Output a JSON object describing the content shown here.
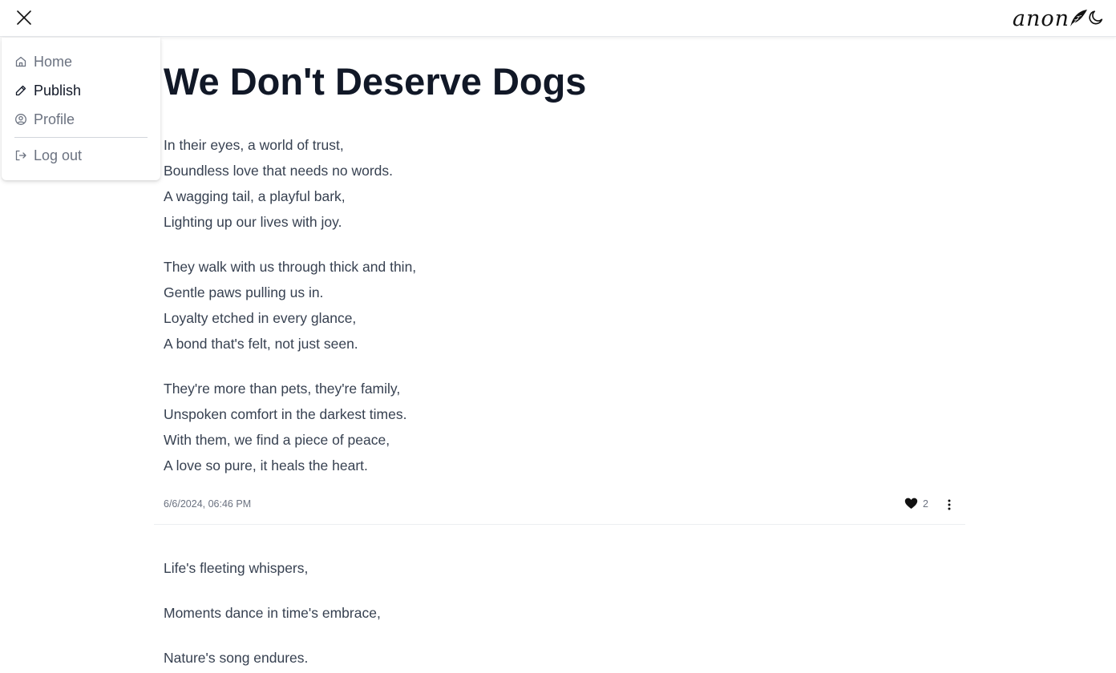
{
  "header": {
    "brand": "anon",
    "brand_icon": "feather-icon",
    "close_icon": "close-icon",
    "theme_icon": "moon-icon"
  },
  "menu": {
    "items": [
      {
        "label": "Home",
        "icon": "home-icon"
      },
      {
        "label": "Publish",
        "icon": "pencil-icon"
      },
      {
        "label": "Profile",
        "icon": "user-circle-icon"
      },
      {
        "label": "Log out",
        "icon": "logout-icon"
      }
    ]
  },
  "posts": [
    {
      "title": "We Don't Deserve Dogs",
      "stanzas": [
        [
          "In their eyes, a world of trust,",
          "Boundless love that needs no words.",
          "A wagging tail, a playful bark,",
          "Lighting up our lives with joy."
        ],
        [
          "They walk with us through thick and thin,",
          "Gentle paws pulling us in.",
          "Loyalty etched in every glance,",
          "A bond that's felt, not just seen."
        ],
        [
          "They're more than pets, they're family,",
          "Unspoken comfort in the darkest times.",
          "With them, we find a piece of peace,",
          "A love so pure, it heals the heart."
        ]
      ],
      "date": "6/6/2024, 06:46 PM",
      "likes": "2"
    },
    {
      "title": "",
      "stanzas": [
        [
          "Life's fleeting whispers,"
        ],
        [
          "Moments dance in time's embrace,"
        ],
        [
          "Nature's song endures."
        ]
      ]
    }
  ],
  "colors": {
    "text_primary": "#111827",
    "text_body": "#374151",
    "text_muted": "#6b7280"
  }
}
